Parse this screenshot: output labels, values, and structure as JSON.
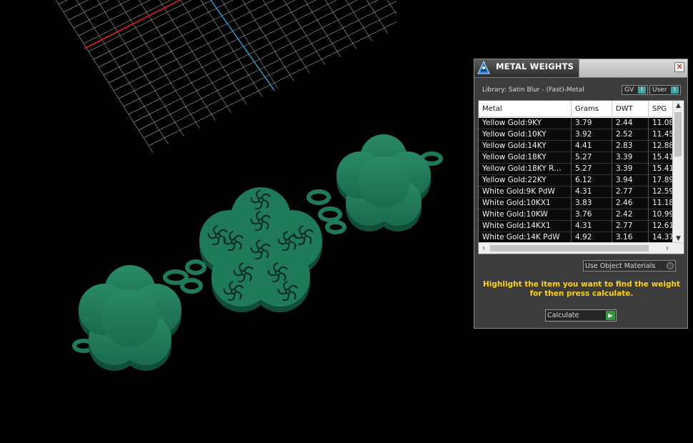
{
  "panel": {
    "title": "METAL WEIGHTS",
    "close_icon": "close-icon",
    "library_label": "Library: Satin Blur - (Fast)-Metal",
    "gv_label": "GV",
    "user_label": "User",
    "toggle_glyph": "I"
  },
  "table": {
    "columns": [
      "Metal",
      "Grams",
      "DWT",
      "SPG"
    ],
    "rows": [
      [
        "Yellow Gold:9KY",
        "3.79",
        "2.44",
        "11.08"
      ],
      [
        "Yellow Gold:10KY",
        "3.92",
        "2.52",
        "11.45"
      ],
      [
        "Yellow Gold:14KY",
        "4.41",
        "2.83",
        "12.88"
      ],
      [
        "Yellow Gold:18KY",
        "5.27",
        "3.39",
        "15.41"
      ],
      [
        "Yellow Gold:18KY R…",
        "5.27",
        "3.39",
        "15.41"
      ],
      [
        "Yellow Gold:22KY",
        "6.12",
        "3.94",
        "17.89"
      ],
      [
        "White Gold:9K PdW",
        "4.31",
        "2.77",
        "12.59"
      ],
      [
        "White Gold:10KX1",
        "3.83",
        "2.46",
        "11.18"
      ],
      [
        "White Gold:10KW",
        "3.76",
        "2.42",
        "10.99"
      ],
      [
        "White Gold:14KX1",
        "4.31",
        "2.77",
        "12.61"
      ],
      [
        "White Gold:14K PdW",
        "4.92",
        "3.16",
        "14.37"
      ]
    ]
  },
  "options": {
    "use_object_materials_label": "Use Object Materials",
    "use_object_materials_checked": false
  },
  "hint_text": "Highlight the item you want to find the weight for then press calculate.",
  "calculate_label": "Calculate",
  "colors": {
    "model_green": "#1f7a5a",
    "grid_line": "#9a9a9a",
    "axis_x": "#e02020",
    "axis_y": "#28a0d8",
    "hint_yellow": "#ffd21a",
    "accent_teal": "#3aa7a7"
  }
}
